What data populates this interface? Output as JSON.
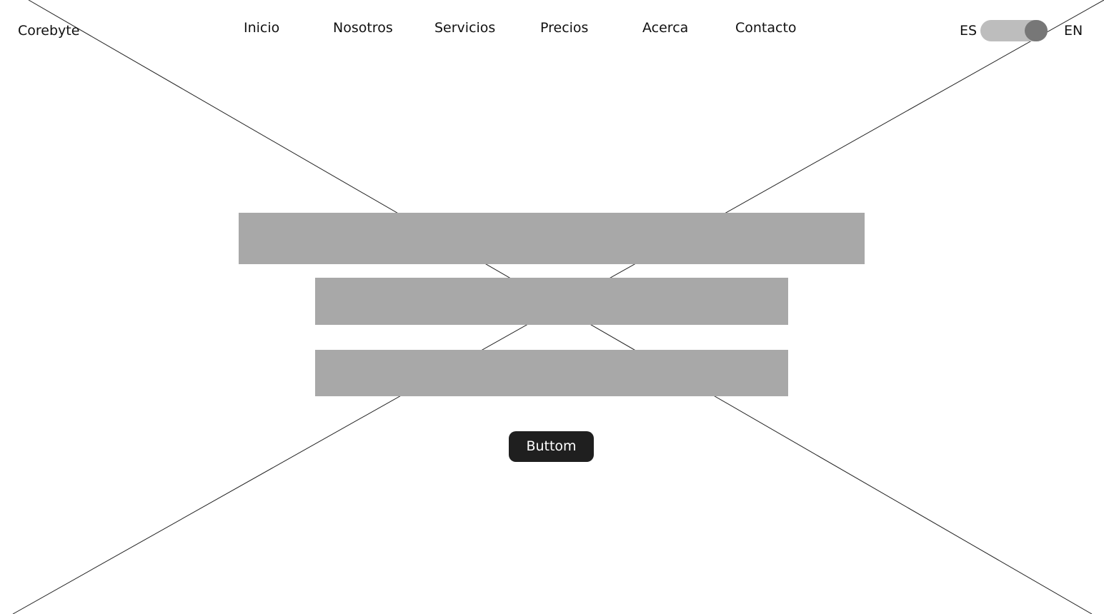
{
  "header": {
    "brand": "Corebyte",
    "nav": [
      {
        "label": "Inicio"
      },
      {
        "label": "Nosotros"
      },
      {
        "label": "Servicios"
      },
      {
        "label": "Precios"
      },
      {
        "label": "Acerca"
      },
      {
        "label": "Contacto"
      }
    ],
    "language": {
      "left_label": "ES",
      "right_label": "EN",
      "selected": "EN"
    }
  },
  "hero": {
    "button_label": "Buttom"
  },
  "colors": {
    "placeholder": "#a8a8a8",
    "button_bg": "#1f1f1f",
    "toggle_track": "#bdbdbd",
    "toggle_knob": "#777777"
  }
}
